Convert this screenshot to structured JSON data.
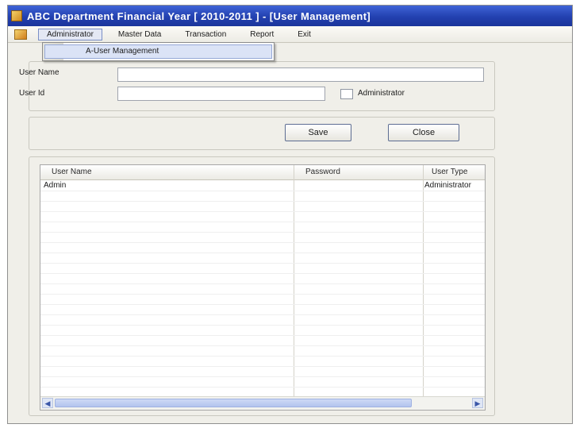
{
  "window": {
    "title": "ABC Department Financial Year [ 2010-2011 ] - [User Management]"
  },
  "menubar": {
    "items": [
      {
        "label": "Administrator"
      },
      {
        "label": "Master Data"
      },
      {
        "label": "Transaction"
      },
      {
        "label": "Report"
      },
      {
        "label": "Exit"
      }
    ],
    "dropdown": {
      "item": "A-User Management"
    }
  },
  "form": {
    "username_label": "User Name",
    "username_value": "",
    "userid_label": "User Id",
    "userid_value": "",
    "admin_checkbox_label": "Administrator",
    "admin_checked": false
  },
  "buttons": {
    "save": "Save",
    "close": "Close"
  },
  "grid": {
    "columns": [
      "User Name",
      "Password",
      "User Type"
    ],
    "rows": [
      [
        "Admin",
        "",
        "Administrator"
      ]
    ]
  },
  "colors": {
    "titlebar": "#2341b0",
    "accent": "#7a8fc6"
  },
  "icons": {
    "app": "app-icon",
    "mdi": "mdi-child-icon",
    "scroll_left": "chevron-left-icon",
    "scroll_right": "chevron-right-icon"
  }
}
